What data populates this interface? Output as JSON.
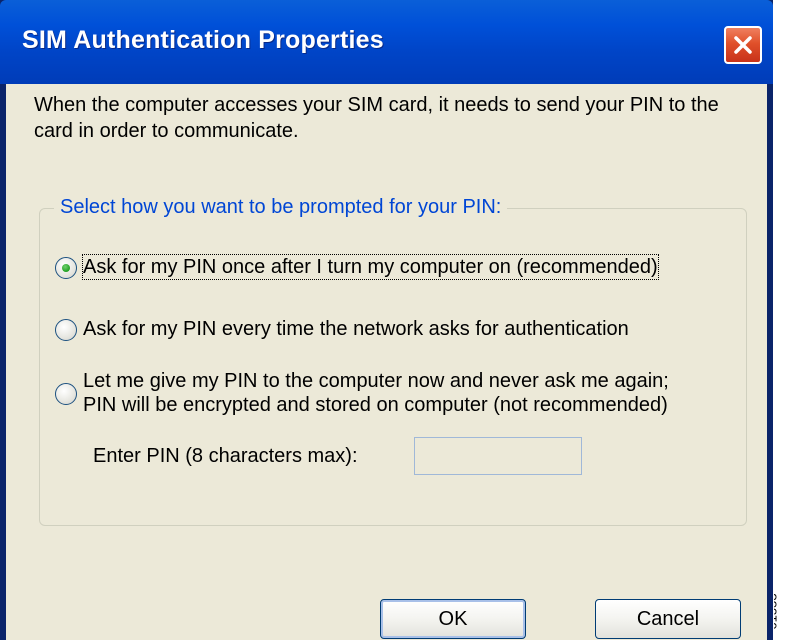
{
  "window": {
    "title": "SIM Authentication Properties"
  },
  "intro": {
    "text": "When the computer accesses your SIM card, it needs to send your PIN to the card in order to communicate."
  },
  "group": {
    "legend": "Select how you want to be prompted for your PIN:",
    "options": [
      {
        "label": "Ask for my PIN once after I turn my computer on (recommended)",
        "selected": true
      },
      {
        "label": "Ask for my PIN every time the network asks for authentication",
        "selected": false
      },
      {
        "label_line1": "Let me give my PIN to the computer now and never ask me again;",
        "label_line2": "PIN will be encrypted and stored on computer (not recommended)",
        "selected": false
      }
    ],
    "pin_label": "Enter PIN (8 characters max):",
    "pin_value": ""
  },
  "buttons": {
    "ok": "OK",
    "cancel": "Cancel"
  },
  "side_mark": "61553",
  "colors": {
    "titlebar": "#0050d8",
    "client_bg": "#ece9d8",
    "legend_text": "#0046d5",
    "close_button": "#e0502a"
  }
}
